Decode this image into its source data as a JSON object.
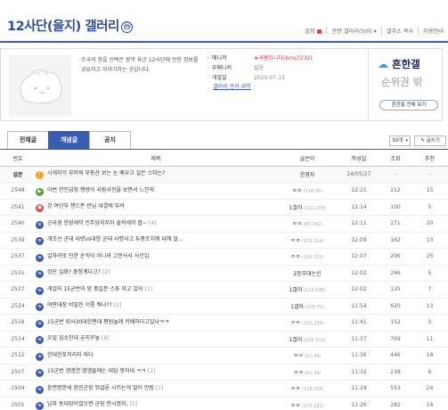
{
  "header": {
    "title": "12사단(을지) 갤러리",
    "badge": "ⓜ",
    "menu": [
      {
        "label": "설정",
        "accent": "■",
        "red": true
      },
      {
        "label": "관련 갤러리(0/0)",
        "accent": "▾",
        "red": false
      },
      {
        "label": "갤주소 복사",
        "accent": "",
        "red": false
      },
      {
        "label": "이용안내",
        "accent": "",
        "red": false
      }
    ]
  },
  "info": {
    "description": "조국의 창을 선택은 광역 육군 12사단에 관한 정보를 공유하고 이야기하는 곳입니다.",
    "rows": [
      {
        "key": "매니저",
        "value": "★재홍입니다(bms7232)",
        "red": true
      },
      {
        "key": "부매니저",
        "value": "없음",
        "red": false
      },
      {
        "key": "개설일",
        "value": "2020-07-13",
        "red": false
      }
    ],
    "link": "갤러리 관리 내역",
    "ad": {
      "logo": "흔한갤",
      "sub": "순위권 밖",
      "button": "흔한갤 전체 보기"
    }
  },
  "tabs": [
    "전체글",
    "개념글",
    "공지"
  ],
  "controls": {
    "count_select": "30개",
    "notice_button": "글쓰기"
  },
  "table": {
    "headers": [
      "번호",
      "제목",
      "글쓴이",
      "작성일",
      "조회",
      "추천"
    ],
    "rows": [
      {
        "num": "설문",
        "icon": "notice",
        "subject": "시세차익 부러워 부동산 보는 눈 배우고 싶은 스타는?",
        "comments": "",
        "writer": "운영자",
        "ip": "",
        "date": "24/05/27",
        "views": "-",
        "rec": "-"
      },
      {
        "num": "2548",
        "icon": "vid",
        "subject": "이번 한전급정 행방이 사람사전을 보면서 느낀게",
        "comments": "",
        "writer": "ㅇㅇ",
        "ip": "(118.35)",
        "date": "12:21",
        "views": "212",
        "rec": "15"
      },
      {
        "num": "2541",
        "icon": "img",
        "subject": "강 여단부 핸드폰 반납 대결에 뚜려",
        "comments": "",
        "writer": "1갤러",
        "ip": "(121.183)",
        "date": "12:14",
        "views": "100",
        "rec": "5"
      },
      {
        "num": "2540",
        "icon": "reg",
        "subject": "군사경 한장세끼 민주당지지자 들락세끼 팝~",
        "comments": "[4]",
        "writer": "ㅇㅇ",
        "ip": "(45.142)",
        "date": "12:11",
        "views": "271",
        "rec": "20"
      },
      {
        "num": "2539",
        "icon": "reg",
        "subject": "개조선 군대 사령vs대한 군대 사령사고 두총조치에 대해 알...",
        "comments": "",
        "writer": "ㅇㅇ",
        "ip": "(172.224)",
        "date": "12:09",
        "views": "162",
        "rec": "10"
      },
      {
        "num": "2537",
        "icon": "reg",
        "subject": "얼차려로 인한 순직이 아니라 고문사사 사건임",
        "comments": "",
        "writer": "ㅇㅇ",
        "ip": "(106.101)",
        "date": "12:07",
        "views": "296",
        "rec": "25"
      },
      {
        "num": "2531",
        "icon": "reg",
        "subject": "징단 심화? 중창계다고?",
        "comments": "[2]",
        "writer": "2등부대는신",
        "ip": "",
        "date": "12:02",
        "views": "246",
        "rec": "5"
      },
      {
        "num": "2527",
        "icon": "reg",
        "subject": "개얼지 15군번이 밤 중길문 스튜 미고 있어",
        "comments": "[1]",
        "writer": "1갤러",
        "ip": "(119.198)",
        "date": "12:02",
        "views": "125",
        "rec": "7"
      },
      {
        "num": "2524",
        "icon": "reg",
        "subject": "여판대장 비밀전 이름 뭐냐??",
        "comments": "[2]",
        "writer": "1갤러",
        "ip": "(105.70)",
        "date": "11:54",
        "views": "620",
        "rec": "13"
      },
      {
        "num": "2516",
        "icon": "reg",
        "subject": "15군번 회사30대한편대 평원놀레 키배하다고있냐ㅋㅋ",
        "comments": "",
        "writer": "ㅇㅇ",
        "ip": "(211.235)",
        "date": "11:41",
        "views": "152",
        "rec": "5"
      },
      {
        "num": "2514",
        "icon": "reg",
        "subject": "오일 입소인데 궁지꾸놓",
        "comments": "[6]",
        "writer": "1갤러",
        "ip": "(106.101)",
        "date": "11:37",
        "views": "769",
        "rec": "11"
      },
      {
        "num": "2512",
        "icon": "reg",
        "subject": "한대한포커리지 마다",
        "comments": "",
        "writer": "ㅇㅇ",
        "ip": "(61.39)",
        "date": "11:36",
        "views": "446",
        "rec": "18"
      },
      {
        "num": "2507",
        "icon": "reg",
        "subject": "15군번 엠엠연 앱엠들에는 대답 못하네 ㅋㅋ",
        "comments": "[1]",
        "writer": "ㅇㅇ",
        "ip": "(61.39)",
        "date": "11:32",
        "views": "238",
        "rec": "6"
      },
      {
        "num": "2504",
        "icon": "reg",
        "subject": "훈련병한테 완진군장 뛰걸론 시키는게 말이 안됨",
        "comments": "[1]",
        "writer": "ㅇㅇ",
        "ip": "(118.235)",
        "date": "11:29",
        "views": "553",
        "rec": "24"
      },
      {
        "num": "2501",
        "icon": "reg",
        "subject": "남자 동대장이었으면 군장 안시켰지,",
        "comments": "[1]",
        "writer": "ㅇㅇ",
        "ip": "(175.192)",
        "date": "11:26",
        "views": "282",
        "rec": "14"
      },
      {
        "num": "2499",
        "icon": "reg",
        "subject": "저 15여혁교인데 넷 외이 많이 빌린거지",
        "comments": "[5]",
        "writer": "ㅇㅇ",
        "ip": "(221.39)",
        "date": "11:24",
        "views": "282",
        "rec": "9"
      }
    ]
  },
  "colors": {
    "accent": "#3b5db1",
    "red": "#e0383e",
    "notice_icon": "#f5a623"
  }
}
